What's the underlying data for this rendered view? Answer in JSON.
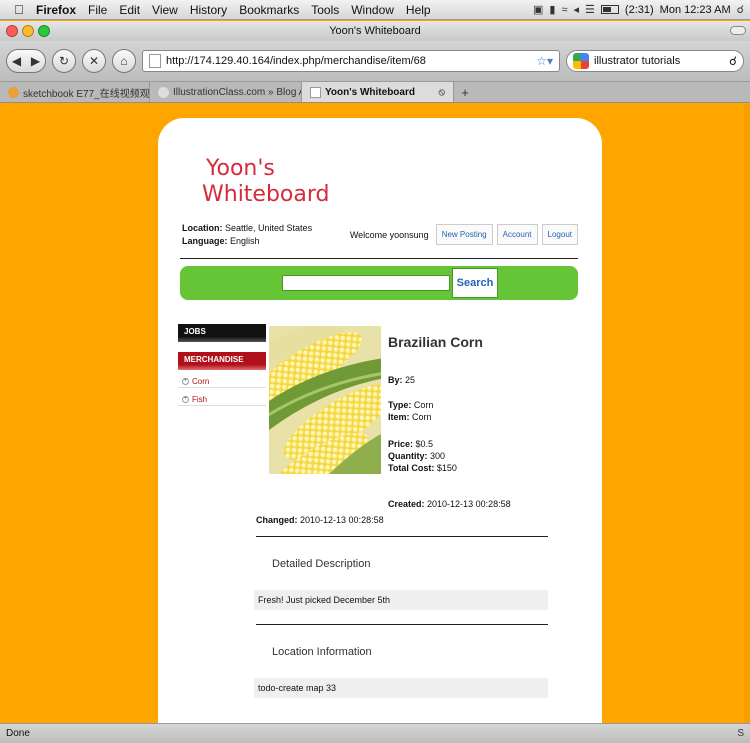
{
  "menubar": {
    "apple": "",
    "app_name": "Firefox",
    "items": [
      "File",
      "Edit",
      "View",
      "History",
      "Bookmarks",
      "Tools",
      "Window",
      "Help"
    ],
    "battery_text": "(2:31)",
    "clock": "Mon 12:23 AM"
  },
  "window": {
    "title": "Yoon's Whiteboard"
  },
  "toolbar": {
    "url": "http://174.129.40.164/index.php/merchandise/item/68",
    "search_value": "illustrator tutorials"
  },
  "tabs": [
    {
      "label": "sketchbook E77_在线视频观看_土...",
      "active": false
    },
    {
      "label": "IllustrationClass.com » Blog Ar...",
      "active": false
    },
    {
      "label": "Yoon's Whiteboard",
      "active": true
    }
  ],
  "site": {
    "logo_line1": "Yoon's",
    "logo_line2": "Whiteboard",
    "location_label": "Location:",
    "location_value": "Seattle, United States",
    "language_label": "Language:",
    "language_value": "English",
    "welcome": "Welcome yoonsung",
    "new_posting": "New Posting",
    "account": "Account",
    "logout": "Logout",
    "search_button": "Search"
  },
  "sidebar": {
    "jobs": "JOBS",
    "merchandise": "MERCHANDISE",
    "items": [
      "Corn",
      "Fish"
    ]
  },
  "item": {
    "title": "Brazilian Corn",
    "by_label": "By:",
    "by_value": "25",
    "type_label": "Type:",
    "type_value": "Corn",
    "item_label": "Item:",
    "item_value": "Corn",
    "price_label": "Price:",
    "price_value": "$0.5",
    "quantity_label": "Quantity:",
    "quantity_value": "300",
    "total_label": "Total Cost:",
    "total_value": "$150",
    "created_label": "Created:",
    "created_value": "2010-12-13 00:28:58",
    "changed_label": "Changed:",
    "changed_value": "2010-12-13 00:28:58",
    "desc_heading": "Detailed Description",
    "desc_text": "Fresh! Just picked December 5th",
    "loc_heading": "Location Information",
    "loc_text": "todo-create map 33"
  },
  "status": {
    "text": "Done",
    "right": "S"
  },
  "colors": {
    "page_bg": "#ffa500",
    "logo": "#d52b3c",
    "search_strip": "#66c437",
    "link_blue": "#2164b4",
    "merch_red": "#b0101a"
  }
}
